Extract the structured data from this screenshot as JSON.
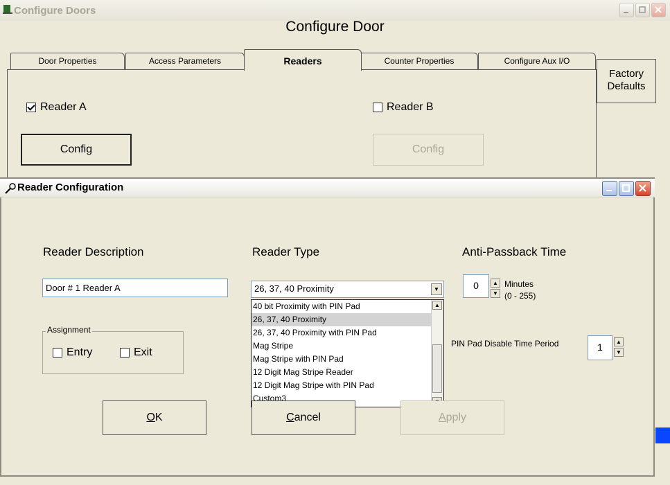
{
  "outer": {
    "title": "Configure Doors",
    "heading": "Configure Door",
    "tabs": [
      "Door Properties",
      "Access Parameters",
      "Readers",
      "Counter Properties",
      "Configure Aux I/O"
    ],
    "active_tab": "Readers",
    "reader_a_label": "Reader A",
    "reader_a_checked": true,
    "reader_b_label": "Reader B",
    "reader_b_checked": false,
    "config_a_label": "Config",
    "config_b_label": "Config",
    "factory_line1": "Factory",
    "factory_line2": "Defaults"
  },
  "dialog": {
    "title": "Reader Configuration",
    "desc_label": "Reader Description",
    "desc_value": "Door # 1 Reader A",
    "type_label": "Reader Type",
    "type_value": "26, 37, 40 Proximity",
    "apb_label": "Anti-Passback Time",
    "apb_value": "0",
    "apb_unit": "Minutes",
    "apb_range": "(0 - 255)",
    "assignment_legend": "Assignment",
    "entry_label": "Entry",
    "exit_label": "Exit",
    "pin_label": "PIN Pad Disable Time Period",
    "pin_value": "1",
    "ok_key": "O",
    "ok_rest": "K",
    "cancel_key": "C",
    "cancel_rest": "ancel",
    "apply_key": "A",
    "apply_rest": "pply",
    "reader_types": [
      "40 bit Proximity with PIN Pad",
      "26, 37, 40 Proximity",
      "26, 37, 40 Proximity with PIN Pad",
      "Mag Stripe",
      "Mag Stripe with PIN Pad",
      "12 Digit Mag Stripe Reader",
      "12 Digit Mag Stripe with PIN Pad",
      "Custom3"
    ],
    "selected_index": 1
  },
  "colors": {
    "accent_blue": "#0a46ff",
    "selection_gray": "#d3d3d3"
  }
}
